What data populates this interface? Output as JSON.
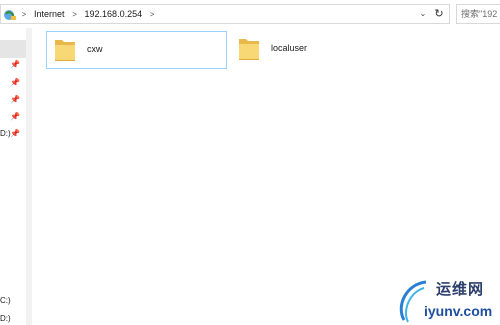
{
  "address_bar": {
    "crumbs": [
      "Internet",
      "192.168.0.254"
    ],
    "separators": [
      ">",
      ">",
      ">"
    ]
  },
  "search": {
    "placeholder": "搜索\"192"
  },
  "nav_pane": {
    "drives": [
      "D:)",
      "C:)",
      "D:)"
    ]
  },
  "content": {
    "items": [
      {
        "label": "cxw",
        "type": "folder",
        "selected": true
      },
      {
        "label": "localuser",
        "type": "folder",
        "selected": false
      }
    ]
  },
  "watermark": {
    "cn": "运维网",
    "en": "iyunv.com"
  },
  "colors": {
    "folder_yellow": "#f8d775",
    "folder_dark": "#e8b84a",
    "selection_border": "#99d1ff",
    "watermark_blue": "#1f4fa0"
  }
}
